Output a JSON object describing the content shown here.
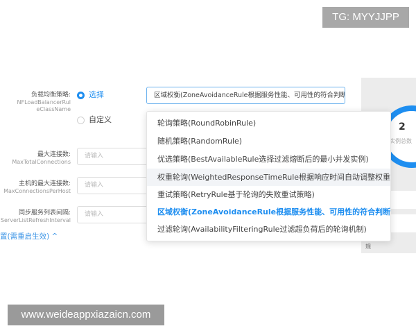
{
  "watermarks": {
    "top": "TG: MYYJJPP",
    "bottom": "www.weideappxiazaicn.com"
  },
  "strategy": {
    "label": "负载均衡策略:",
    "sub_label": "NFLoadBalancerRuleClassName",
    "options": [
      {
        "label": "选择",
        "checked": true
      },
      {
        "label": "自定义",
        "checked": false
      }
    ],
    "selected_value": "区域权衡(ZoneAvoidanceRule根据服务性能、可用性的符合判断)",
    "dropdown": [
      "轮询策略(RoundRobinRule)",
      "随机策略(RandomRule)",
      "优选策略(BestAvailableRule选择过滤熔断后的最小并发实例)",
      "权重轮询(WeightedResponseTimeRule根据响应时间自动调整权重)",
      "重试策略(RetryRule基于轮询的失败重试策略)",
      "区域权衡(ZoneAvoidanceRule根据服务性能、可用性的符合判断)",
      "过滤轮询(AvailabilityFilteringRule过滤超负荷后的轮询机制)"
    ],
    "hover_index": 3,
    "selected_index": 5
  },
  "fields": [
    {
      "label": "最大连接数:",
      "sub": "MaxTotalConnections",
      "placeholder": "请输入"
    },
    {
      "label": "主机的最大连接数:",
      "sub": "MaxConnectionsPerHost",
      "placeholder": "请输入"
    },
    {
      "label": "同步服务列表间隔:",
      "sub": "ServerListRefreshInterval",
      "placeholder": "请输入"
    }
  ],
  "advanced_link": "置(需重启生效) ^",
  "stats": {
    "value": "2",
    "caption": "实例总数"
  },
  "panel_hint": "规",
  "colors": {
    "accent": "#1e8ef0",
    "selected_text": "#1e8ef0"
  }
}
